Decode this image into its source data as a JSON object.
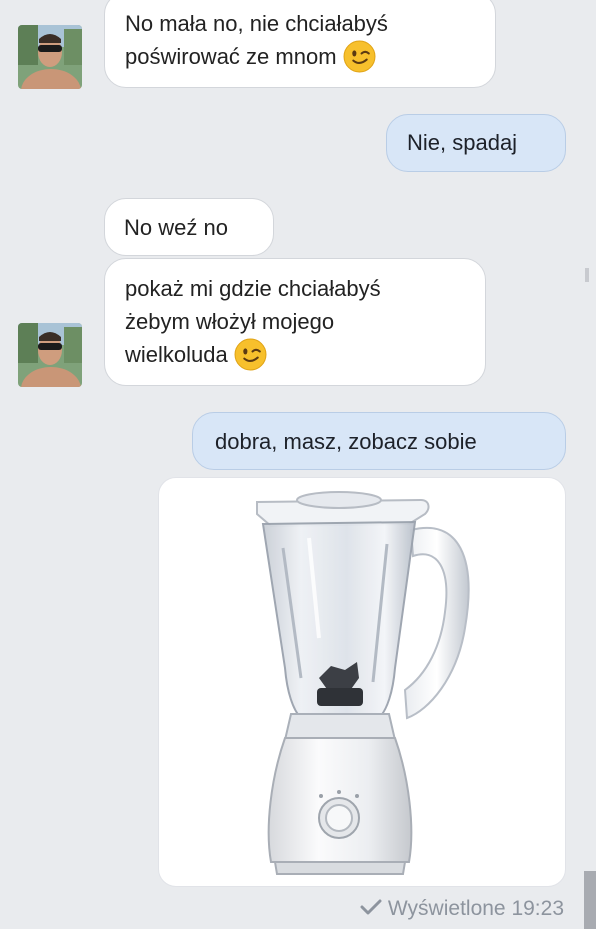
{
  "messages": [
    {
      "from": "them",
      "lines": [
        "No mała no, nie chciałabyś",
        "poświrować ze mnom"
      ],
      "emoji": "winking-face"
    },
    {
      "from": "me",
      "text": "Nie, spadaj"
    },
    {
      "from": "them",
      "text": "No weź no"
    },
    {
      "from": "them",
      "lines": [
        "pokaż mi gdzie chciałabyś",
        "żebym włożył mojego",
        "wielkoluda"
      ],
      "emoji": "winking-face"
    },
    {
      "from": "me",
      "text": "dobra, masz, zobacz sobie"
    },
    {
      "from": "me",
      "attachment": "blender-photo"
    }
  ],
  "status": {
    "seen_text": "Wyświetlone 19:23",
    "icon": "checkmark-icon"
  },
  "colors": {
    "background": "#e9ebee",
    "incoming_bubble": "#ffffff",
    "outgoing_bubble": "#d8e6f7",
    "status_text": "#8d949e"
  }
}
